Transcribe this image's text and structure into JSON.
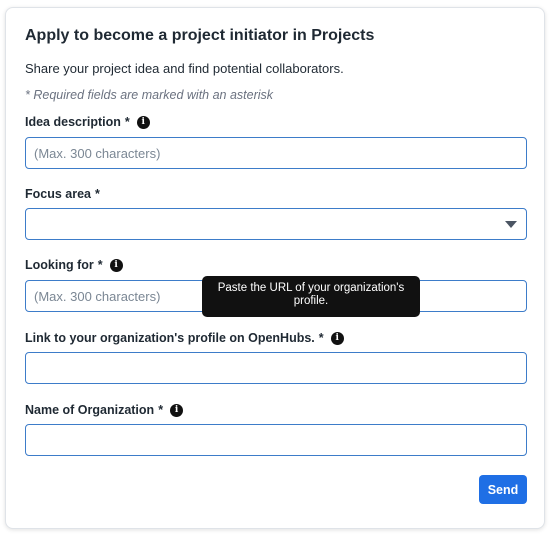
{
  "form": {
    "title": "Apply to become a project initiator in Projects",
    "subtitle": "Share your project idea and find potential collaborators.",
    "required_note": "* Required fields are marked with an asterisk",
    "fields": {
      "idea_description": {
        "label": "Idea description",
        "required_mark": "*",
        "info_icon": "info-icon",
        "placeholder": "(Max. 300 characters)",
        "value": ""
      },
      "focus_area": {
        "label": "Focus area",
        "required_mark": "*",
        "selected": ""
      },
      "looking_for": {
        "label": "Looking for",
        "required_mark": "*",
        "info_icon": "info-icon",
        "placeholder": "(Max. 300 characters)",
        "value": ""
      },
      "org_profile_link": {
        "label": "Link to your organization's profile on OpenHubs.",
        "required_mark": "*",
        "info_icon": "info-icon",
        "placeholder": "",
        "value": ""
      },
      "org_name": {
        "label": "Name of Organization",
        "required_mark": "*",
        "info_icon": "info-icon",
        "placeholder": "",
        "value": ""
      }
    },
    "tooltip": "Paste the URL of your organization's profile.",
    "send_label": "Send",
    "info_glyph": "i",
    "colors": {
      "accent": "#1f6fe5",
      "input_border": "#3d7cc9",
      "tooltip_bg": "#111111"
    }
  }
}
